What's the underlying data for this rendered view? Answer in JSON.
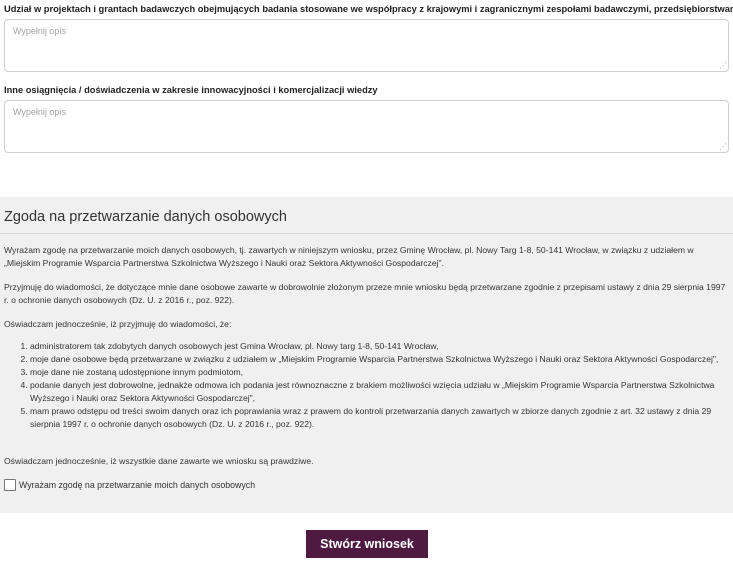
{
  "fields": [
    {
      "label": "Udział w projektach i grantach badawczych obejmujących badania stosowane we współpracy z krajowymi i zagranicznymi zespołami badawczymi, przedsiębiorstwami",
      "placeholder": "Wypełnij opis",
      "value": ""
    },
    {
      "label": "Inne osiągnięcia / doświadczenia w zakresie innowacyjności i komercjalizacji wiedzy",
      "placeholder": "Wypełnij opis",
      "value": ""
    }
  ],
  "consent": {
    "title": "Zgoda na przetwarzanie danych osobowych",
    "para1": "Wyrażam zgodę na przetwarzanie moich danych osobowych, tj. zawartych w niniejszym wniosku, przez Gminę Wrocław, pl. Nowy Targ 1-8, 50-141 Wrocław, w związku z udziałem w „Miejskim Programie Wsparcia Partnerstwa Szkolnictwa Wyższego i Nauki oraz Sektora Aktywności Gospodarczej\".",
    "para2": "Przyjmuję do wiadomości, że dotyczące mnie dane osobowe zawarte w dobrowolnie złożonym przeze mnie wniosku będą przetwarzane zgodnie z przepisami ustawy z dnia 29 sierpnia 1997 r. o ochronie danych osobowych (Dz. U. z 2016 r., poz. 922).",
    "para3": "Oświadczam jednocześnie, iż przyjmuję do wiadomości, że:",
    "list": [
      "administratorem tak zdobytych danych osobowych jest Gmina Wrocław, pl. Nowy targ 1-8, 50-141 Wrocław,",
      "moje dane osobowe będą przetwarzane w związku z udziałem w „Miejskim Programie Wsparcia Partnerstwa Szkolnictwa Wyższego i Nauki oraz Sektora Aktywności Gospodarczej\",",
      "moje dane nie zostaną udostępnione innym podmiotom,",
      "podanie danych jest dobrowolne, jednakże odmowa ich podania jest równoznaczne z brakiem możliwości wzięcia udziału w „Miejskim Programie Wsparcia Partnerstwa Szkolnictwa Wyższego i Nauki oraz Sektora Aktywności Gospodarczej\",",
      "mam prawo odstępu od treści swoim danych oraz ich poprawiania wraz z prawem do kontroli przetwarzania danych zawartych w zbiorze danych zgodnie z art. 32 ustawy z dnia 29 sierpnia 1997 r. o ochronie danych osobowych (Dz. U. z 2016 r., poz. 922)."
    ],
    "para4": "Oświadczam jednocześnie, iż wszystkie dane zawarte we wniosku są prawdziwe.",
    "checkbox_label": "Wyrażam zgodę na przetwarzanie moich danych osobowych",
    "checkbox_checked": false
  },
  "submit_label": "Stwórz wniosek",
  "colors": {
    "submit_bg": "#4e1a41",
    "section_bg": "#f0f0f0"
  }
}
